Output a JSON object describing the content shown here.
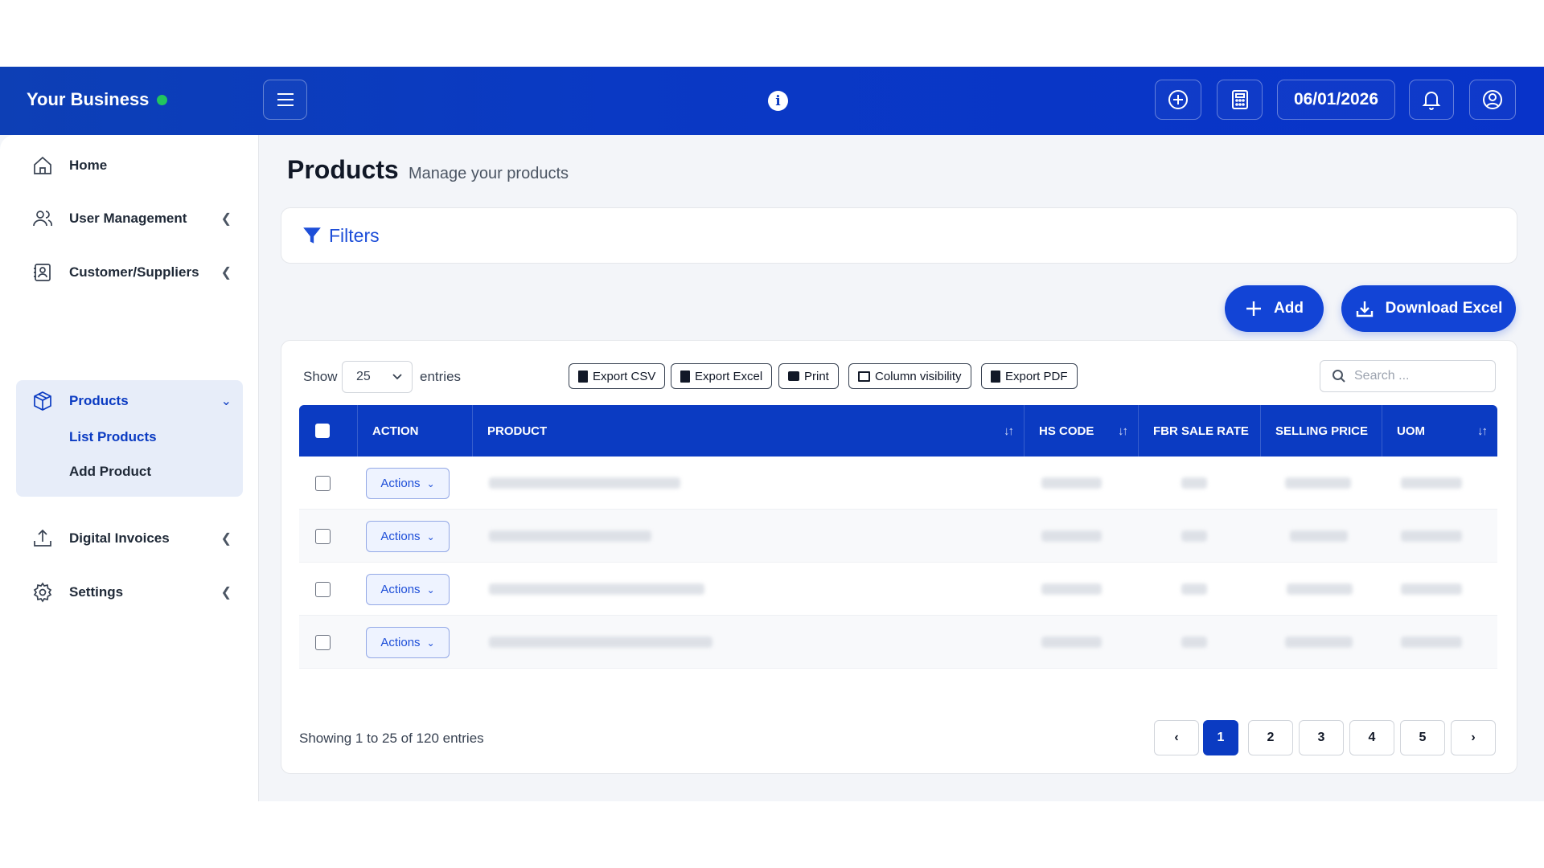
{
  "topbar": {
    "brand": "Your Business",
    "date": "06/01/2026",
    "icons": [
      "menu-icon",
      "info-icon",
      "plus-circle-icon",
      "calculator-icon",
      "bell-icon",
      "user-circle-icon"
    ]
  },
  "sidebar": {
    "items": [
      {
        "label": "Home",
        "icon": "home-icon"
      },
      {
        "label": "User Management",
        "icon": "users-icon"
      },
      {
        "label": "Customer/Suppliers",
        "icon": "contacts-icon"
      },
      {
        "label": "Products",
        "icon": "box-icon"
      },
      {
        "label": "Digital Invoices",
        "icon": "upload-icon"
      },
      {
        "label": "Settings",
        "icon": "gear-icon"
      }
    ],
    "products_sub": [
      "List Products",
      "Add Product"
    ]
  },
  "page": {
    "title": "Products",
    "subtitle": "Manage your products",
    "filters_label": "Filters",
    "add_label": "Add",
    "download_label": "Download Excel"
  },
  "table_controls": {
    "show_label": "Show",
    "entries_value": "25",
    "entries_label": "entries",
    "export_buttons": [
      "Export CSV",
      "Export Excel",
      "Print",
      "Column visibility",
      "Export PDF"
    ],
    "search_placeholder": "Search ..."
  },
  "table": {
    "columns": [
      "ACTION",
      "PRODUCT",
      "HS CODE",
      "FBR SALE RATE",
      "SELLING PRICE",
      "UOM"
    ],
    "rows": [
      {
        "action": "Actions"
      },
      {
        "action": "Actions"
      },
      {
        "action": "Actions"
      },
      {
        "action": "Actions"
      }
    ]
  },
  "pagination": {
    "info": "Showing 1 to 25 of 120 entries",
    "pages": [
      "1",
      "2",
      "3",
      "4",
      "5"
    ],
    "active": "1",
    "prev": "‹",
    "next": "›"
  },
  "colors": {
    "primary": "#0b3bc2",
    "status_online": "#22c55e"
  }
}
